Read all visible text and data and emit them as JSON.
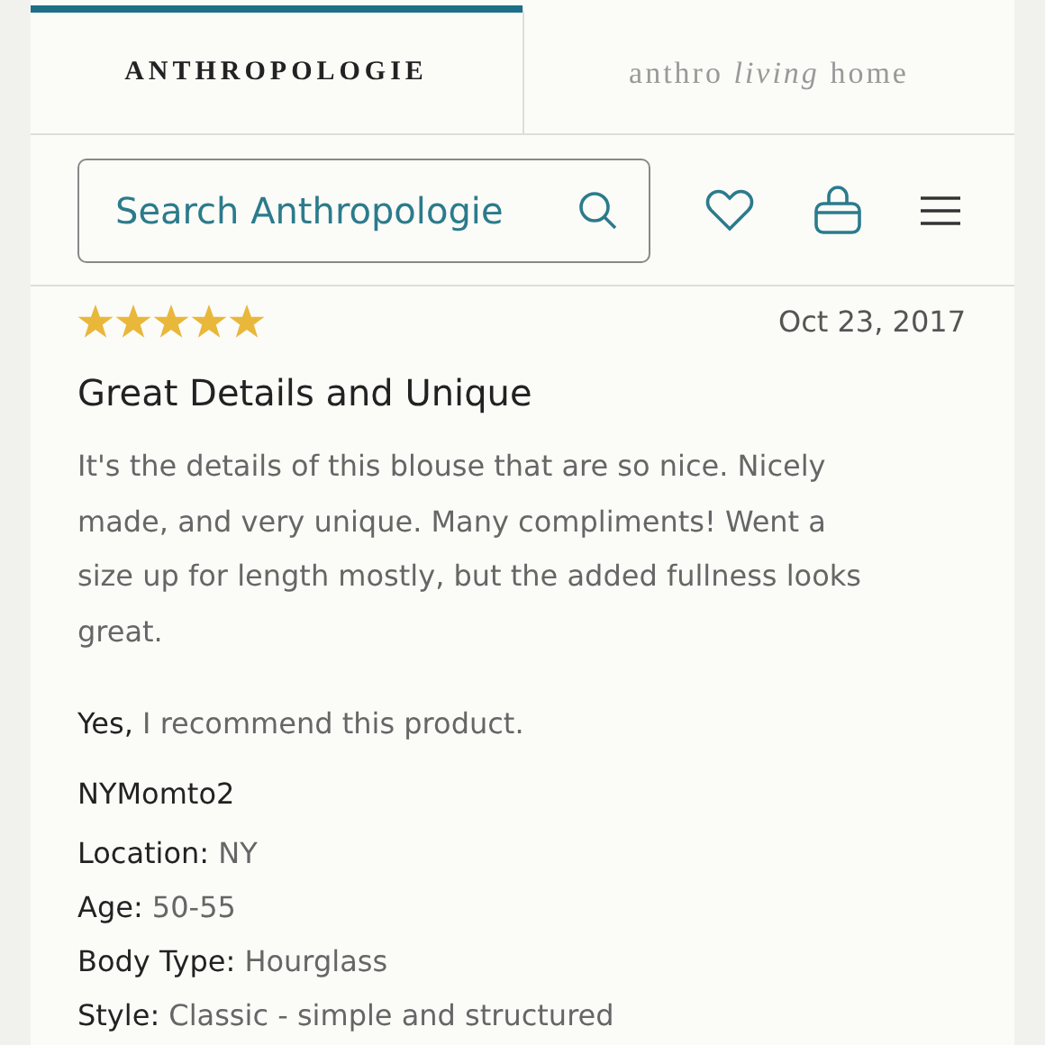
{
  "tabs": [
    {
      "label": "ANTHROPOLOGIE",
      "selected": true,
      "kind": "caps"
    },
    {
      "label": "anthro *living* home",
      "selected": false,
      "kind": "script"
    }
  ],
  "search": {
    "placeholder": "Search Anthropologie"
  },
  "review": {
    "stars": 5,
    "date": "Oct 23, 2017",
    "title": "Great Details and Unique",
    "body": "It's the details of this blouse that are so nice. Nicely made, and very unique. Many compliments! Went a size up for length mostly, but the added fullness looks great.",
    "recommendation": "**Yes,** I recommend this product.",
    "author": "NYMomto2",
    "attributes": [
      "**Location:** NY",
      "**Age:** 50-55",
      "**Body Type:** Hourglass",
      "**Style:** Classic - simple and structured"
    ]
  }
}
